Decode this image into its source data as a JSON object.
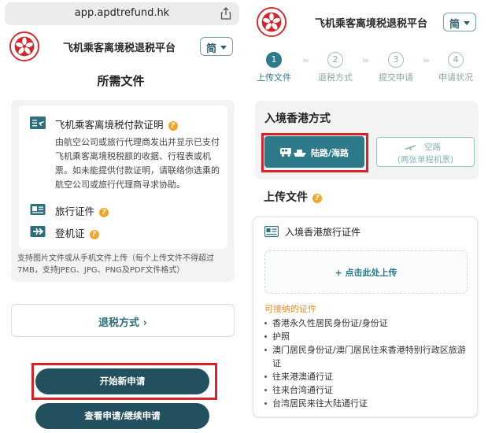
{
  "browser": {
    "url": "app.apdtrefund.hk"
  },
  "header": {
    "title": "飞机乘客离境税退税平台",
    "lang_label": "简"
  },
  "left": {
    "section_title": "所需文件",
    "docs": [
      {
        "label": "飞机乘客离境税付款证明",
        "icon": "receipt-plane-icon"
      },
      {
        "label": "旅行证件",
        "icon": "id-card-icon"
      },
      {
        "label": "登机证",
        "icon": "boarding-pass-icon"
      }
    ],
    "doc_desc": "由航空公司或旅行代理商发出并显示已支付飞机乘客离境税税额的收据、行程表或机票。如未能提供付款证明，请联络你选乘的航空公司或旅行代理商寻求协助。",
    "support_text": "支持图片文件或从手机文件上传（每个上传文件不得超过7MB，支持JPEG、JPG、PNG及PDF文件格式）",
    "refund_method": "退税方式",
    "start_button": "开始新申请",
    "view_button": "查看申请/继续申请"
  },
  "right": {
    "steps": [
      {
        "num": "1",
        "label": "上传文件"
      },
      {
        "num": "2",
        "label": "退税方式"
      },
      {
        "num": "3",
        "label": "提交申请"
      },
      {
        "num": "4",
        "label": "申请状况"
      }
    ],
    "entry_title": "入境香港方式",
    "land_sea": "陆路/海路",
    "air_line1": "空路",
    "air_line2": "(两张单程机票)",
    "upload_title": "上传文件",
    "card_title": "入境香港旅行证件",
    "dropzone_label": "+ 点击此处上传",
    "accept_title": "可接纳的证件",
    "accept_list": [
      "香港永久性居民身份证/身份证",
      "护照",
      "澳门居民身份证/澳门居民往来香港特别行政区旅游证",
      "往来港澳通行证",
      "往来台湾通行证",
      "台湾居民来往大陆通行证"
    ]
  },
  "colors": {
    "primary": "#22505e",
    "accent": "#2c7a8a",
    "highlight": "#d7222a",
    "warn": "#f0a72b"
  }
}
